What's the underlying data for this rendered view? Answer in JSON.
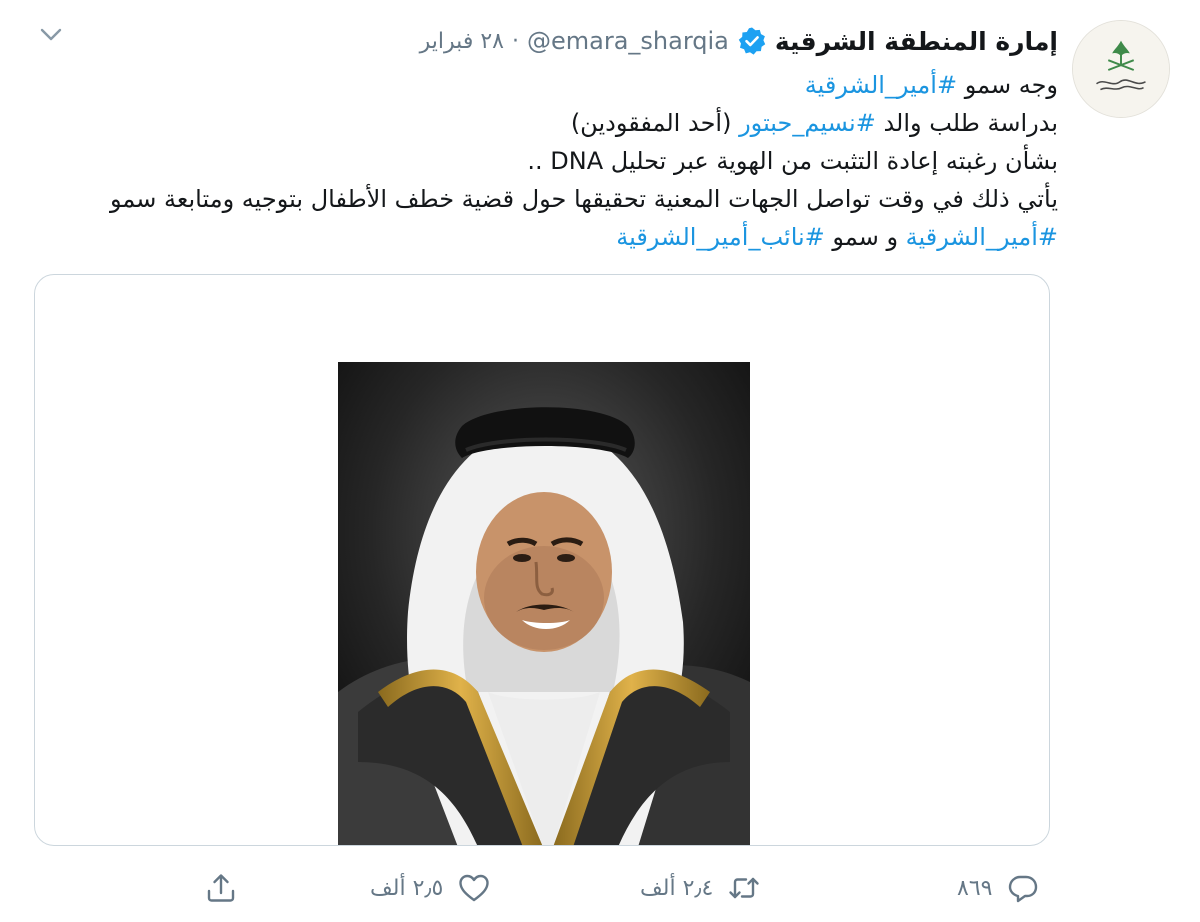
{
  "tweet": {
    "author_name": "إمارة المنطقة الشرقية",
    "handle": "@emara_sharqia",
    "separator": "·",
    "date": "٢٨ فبراير",
    "lines": [
      {
        "text": "وجه سمو ",
        "tag": "#أمير_الشرقية"
      },
      {
        "text_a": "بدراسة طلب والد ",
        "tag": "#نسيم_حبتور",
        "text_b": " (أحد المفقودين)"
      },
      {
        "text": "بشأن رغبته إعادة التثبت من الهوية عبر تحليل DNA .."
      },
      {
        "text": "يأتي ذلك في وقت تواصل الجهات المعنية تحقيقها حول قضية خطف الأطفال بتوجيه ومتابعة سمو"
      },
      {
        "tag_a": "#أمير_الشرقية",
        "text": " و سمو ",
        "tag_b": "#نائب_أمير_الشرقية"
      }
    ]
  },
  "actions": {
    "reply_count": "٨٦٩",
    "retweet_count": "٢٫٤ ألف",
    "like_count": "٢٫٥ ألف"
  },
  "icons": {
    "verified": "verified-badge-icon",
    "caret": "chevron-down-icon",
    "reply": "reply-icon",
    "retweet": "retweet-icon",
    "like": "heart-icon",
    "share": "share-icon"
  },
  "colors": {
    "link": "#1b95e0",
    "muted": "#657786",
    "text": "#14171a",
    "verified": "#1da1f2"
  }
}
